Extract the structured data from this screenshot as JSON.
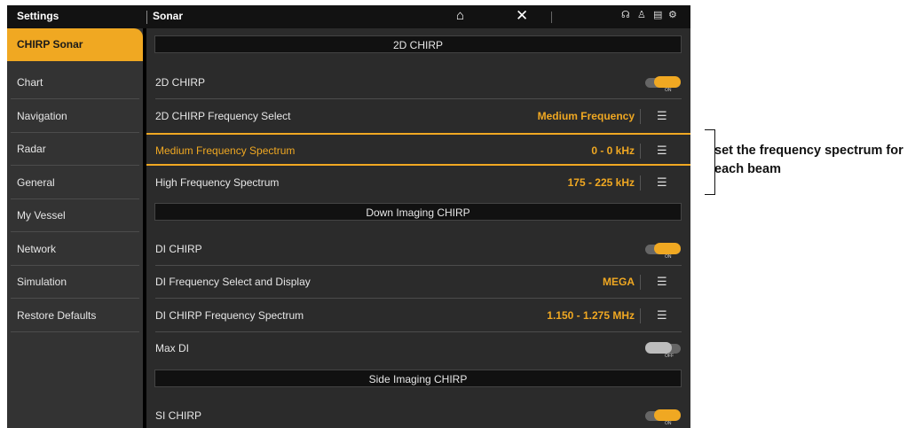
{
  "topbar": {
    "left_title": "Settings",
    "right_title": "Sonar",
    "home_icon": "⌂",
    "close_icon": "✕",
    "status_icons": {
      "gps": "☊",
      "person": "♙",
      "temp": "▤",
      "gear": "⚙"
    }
  },
  "sidebar": {
    "items": [
      {
        "label": "CHIRP Sonar",
        "active": true
      },
      {
        "label": "Chart"
      },
      {
        "label": "Navigation"
      },
      {
        "label": "Radar"
      },
      {
        "label": "General"
      },
      {
        "label": "My Vessel"
      },
      {
        "label": "Network"
      },
      {
        "label": "Simulation"
      },
      {
        "label": "Restore Defaults"
      }
    ]
  },
  "main": {
    "sections": [
      "2D CHIRP",
      "Down Imaging CHIRP",
      "Side Imaging CHIRP"
    ],
    "rows": [
      {
        "label": "2D CHIRP",
        "type": "toggle",
        "state": "ON"
      },
      {
        "label": "2D CHIRP Frequency Select",
        "type": "menu",
        "value": "Medium Frequency"
      },
      {
        "label": "Medium Frequency Spectrum",
        "type": "menu",
        "value": "0 - 0 kHz",
        "highlight": true
      },
      {
        "label": "High Frequency Spectrum",
        "type": "menu",
        "value": "175 - 225 kHz"
      },
      {
        "label": "DI CHIRP",
        "type": "toggle",
        "state": "ON"
      },
      {
        "label": "DI Frequency Select and Display",
        "type": "menu",
        "value": "MEGA"
      },
      {
        "label": "DI CHIRP Frequency Spectrum",
        "type": "menu",
        "value": "1.150 - 1.275 MHz"
      },
      {
        "label": "Max DI",
        "type": "toggle",
        "state": "OFF"
      },
      {
        "label": "SI CHIRP",
        "type": "toggle",
        "state": "ON"
      }
    ],
    "menu_icon": "☰"
  },
  "annotation": {
    "text": "set the frequency spectrum for each beam"
  },
  "colors": {
    "accent": "#f0a822",
    "background": "#2b2b2b",
    "topbar": "#121212"
  }
}
